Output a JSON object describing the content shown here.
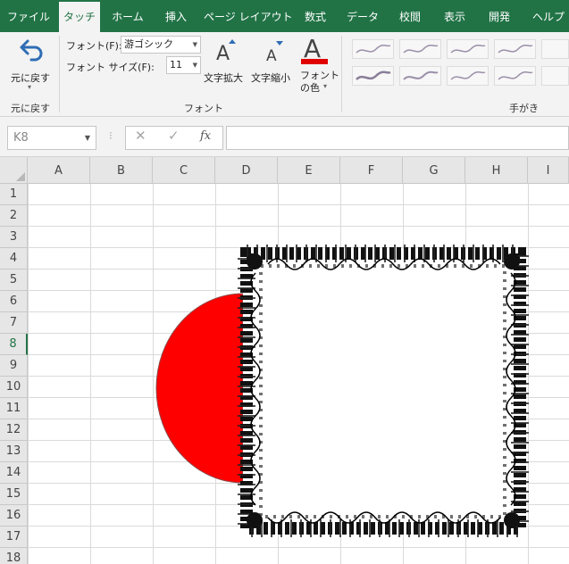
{
  "menu": {
    "tabs": [
      {
        "label": "ファイル",
        "active": false
      },
      {
        "label": "タッチ",
        "active": true
      },
      {
        "label": "ホーム",
        "active": false
      },
      {
        "label": "挿入",
        "active": false
      },
      {
        "label": "ページ レイアウト",
        "active": false
      },
      {
        "label": "数式",
        "active": false
      },
      {
        "label": "データ",
        "active": false
      },
      {
        "label": "校閲",
        "active": false
      },
      {
        "label": "表示",
        "active": false
      },
      {
        "label": "開発",
        "active": false
      },
      {
        "label": "ヘルプ",
        "active": false
      }
    ]
  },
  "ribbon": {
    "undo": {
      "label": "元に戻す",
      "group_label": "元に戻す"
    },
    "font_group": {
      "group_label": "フォント",
      "font_label": "フォント(F):",
      "font_value": "游ゴシック",
      "size_label": "フォント サイズ(F):",
      "size_value": "11",
      "increase_label": "文字拡大",
      "decrease_label": "文字縮小",
      "font_color_label_line1": "フォント",
      "font_color_label_line2": "の色",
      "font_color": "#e00000"
    },
    "ink_group": {
      "group_label": "手がき"
    }
  },
  "formula_bar": {
    "name_box": "K8",
    "cancel_icon": "✕",
    "enter_icon": "✓",
    "fx_label": "fx",
    "formula": ""
  },
  "sheet": {
    "columns": [
      "A",
      "B",
      "C",
      "D",
      "E",
      "F",
      "G",
      "H",
      "I"
    ],
    "rows": [
      "1",
      "2",
      "3",
      "4",
      "5",
      "6",
      "7",
      "8",
      "9",
      "10",
      "11",
      "12",
      "13",
      "14",
      "15",
      "16",
      "17",
      "18"
    ],
    "selected_row": "8",
    "shapes": {
      "half_circle_fill": "#ff0000",
      "frame_color": "#111111"
    }
  },
  "colors": {
    "accent": "#217346",
    "ribbon_bg": "#f3f3f3",
    "header_bg": "#e6e6e6"
  }
}
